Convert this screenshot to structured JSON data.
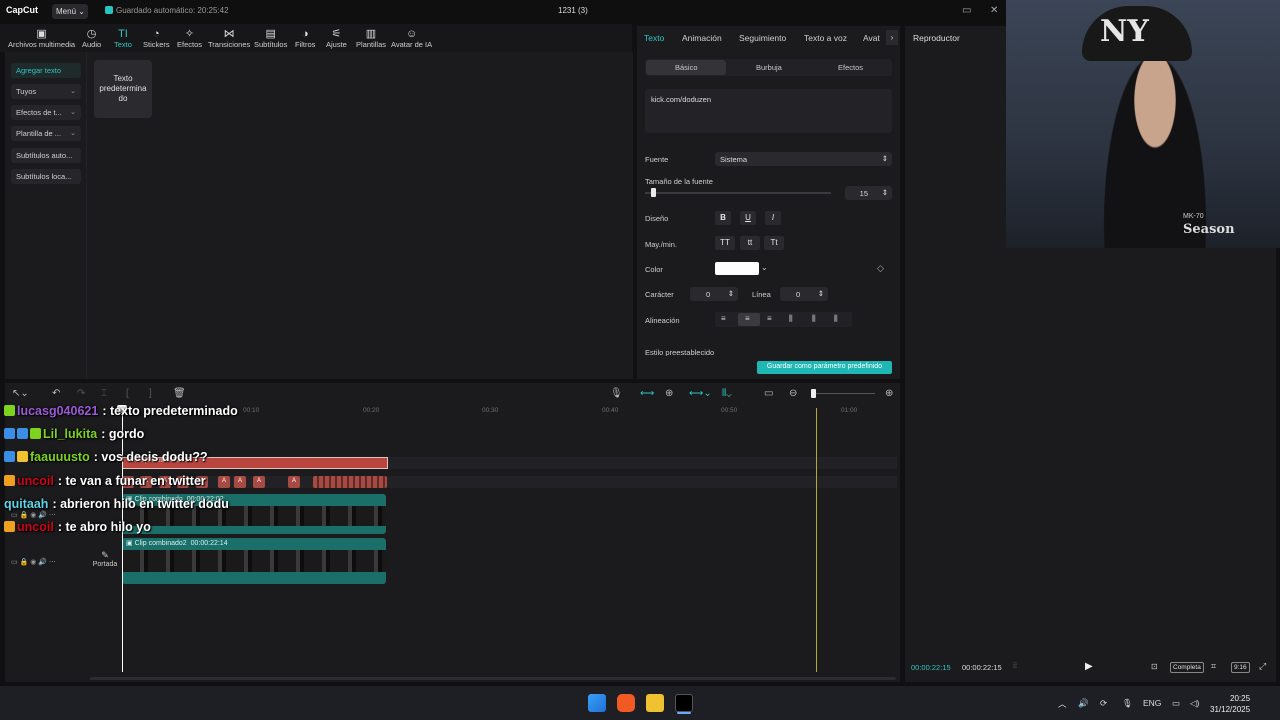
{
  "app": {
    "logo": "CapCut",
    "menu_label": "Menú",
    "autosave": "Guardado automático: 20:25:42",
    "project_title": "1231 (3)"
  },
  "toolbar": {
    "items": [
      {
        "label": "Archivos multimedia",
        "icon": "media-icon",
        "glyph": "▣"
      },
      {
        "label": "Audio",
        "icon": "audio-icon",
        "glyph": "◷"
      },
      {
        "label": "Texto",
        "icon": "text-icon",
        "glyph": "TI"
      },
      {
        "label": "Stickers",
        "icon": "stickers-icon",
        "glyph": "◔"
      },
      {
        "label": "Efectos",
        "icon": "effects-icon",
        "glyph": "✧"
      },
      {
        "label": "Transiciones",
        "icon": "transitions-icon",
        "glyph": "⋈"
      },
      {
        "label": "Subtítulos",
        "icon": "subtitles-icon",
        "glyph": "▤"
      },
      {
        "label": "Filtros",
        "icon": "filters-icon",
        "glyph": "◑"
      },
      {
        "label": "Ajuste",
        "icon": "adjust-icon",
        "glyph": "⚟"
      },
      {
        "label": "Plantillas",
        "icon": "templates-icon",
        "glyph": "▥"
      },
      {
        "label": "Avatar de IA",
        "icon": "ai-avatar-icon",
        "glyph": "☺"
      }
    ]
  },
  "left_nav": {
    "items": [
      "Agregar texto",
      "Tuyos",
      "Efectos de t...",
      "Plantilla de ...",
      "Subtítulos auto...",
      "Subtítulos loca..."
    ]
  },
  "card": {
    "label": "Texto predetermina do"
  },
  "props": {
    "tabs": [
      "Texto",
      "Animación",
      "Seguimiento",
      "Texto a voz",
      "Avat"
    ],
    "subtabs": [
      "Básico",
      "Burbuja",
      "Efectos"
    ],
    "text_value": "kick.com/doduzen",
    "font_label": "Fuente",
    "font_value": "Sistema",
    "size_label": "Tamaño de la fuente",
    "size_value": "15",
    "design_label": "Diseño",
    "design_buttons": [
      "B",
      "U",
      "I"
    ],
    "case_label": "May./min.",
    "case_buttons": [
      "TT",
      "tt",
      "Tt"
    ],
    "color_label": "Color",
    "color_value": "#ffffff",
    "char_label": "Carácter",
    "char_value": "0",
    "line_label": "Línea",
    "line_value": "0",
    "align_label": "Alineación",
    "preset_label": "Estilo preestablecido",
    "save_preset": "Guardar como parámetro predefinido"
  },
  "player": {
    "title": "Reproductor",
    "current_time": "00:00:22:15",
    "total_time": "00:00:22:15",
    "full_label": "Completa",
    "ratio_label": "9:16"
  },
  "timeline": {
    "ruler": [
      "00:10",
      "00:20",
      "00:30",
      "00:40",
      "00:50",
      "01:00"
    ],
    "text_clip": "Texto predeterminado",
    "video_clip_1": {
      "name": "Clip combinado",
      "time": "00:00:22:02"
    },
    "video_clip_2": {
      "name": "Clip combinado2",
      "time": "00:00:22:14"
    },
    "cover_label": "Portada",
    "a_badges": [
      "A",
      "A",
      "A",
      "A",
      "A",
      "A",
      "A",
      "A",
      "A"
    ]
  },
  "chat": [
    {
      "user": "lucasg040621",
      "message": ": texto predeterminado",
      "color": "#9b59d6"
    },
    {
      "user": "Lil_lukita",
      "message": ": gordo",
      "color": "#7ed321"
    },
    {
      "user": "faauuusto",
      "message": ": vos decis dodu??",
      "color": "#7ed321"
    },
    {
      "user": "uncoil",
      "message": ": te van a funar en twitter",
      "color": "#d0021b"
    },
    {
      "user": "quitaah",
      "message": ": abrieron hilo en twitter dodu",
      "color": "#5fd3e8"
    },
    {
      "user": "uncoil",
      "message": ": te abro hilo yo",
      "color": "#d0021b"
    }
  ],
  "webcam": {
    "shirt_small": "MK-70",
    "shirt_brand": "Season"
  },
  "taskbar": {
    "lang": "ENG",
    "time": "20:25",
    "date": "31/12/2025"
  }
}
